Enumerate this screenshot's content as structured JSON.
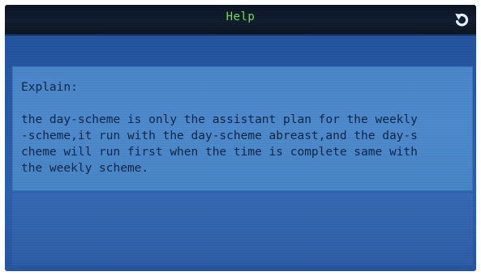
{
  "window": {
    "title": "Help"
  },
  "icons": {
    "back": "back-arrow-icon"
  },
  "colors": {
    "title_text": "#6fe04a",
    "screen_bg": "#2659a6",
    "panel_bg": "#4886c9",
    "body_text": "#0c2144"
  },
  "help": {
    "heading": "Explain:",
    "text": "the day-scheme is only the assistant plan for the weekly\n-scheme,it run with the day-scheme abreast,and the day-s\ncheme will run first when the time is complete same with\nthe weekly scheme."
  }
}
